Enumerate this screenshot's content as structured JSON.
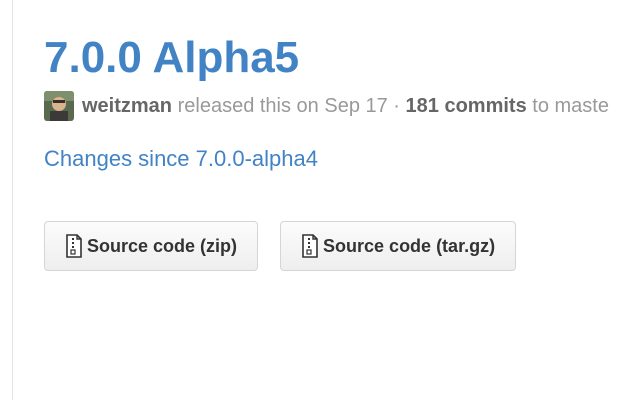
{
  "release": {
    "title": "7.0.0 Alpha5",
    "author": "weitzman",
    "released_text": "released this on Sep 17 ·",
    "commits": "181 commits",
    "to_text": "to maste"
  },
  "changes_link": "Changes since 7.0.0-alpha4",
  "downloads": [
    {
      "label": "Source code (zip)",
      "icon": "file-zip-icon"
    },
    {
      "label": "Source code (tar.gz)",
      "icon": "file-zip-icon"
    }
  ],
  "colors": {
    "link": "#4183c4",
    "muted": "#999999",
    "strong": "#666666"
  }
}
